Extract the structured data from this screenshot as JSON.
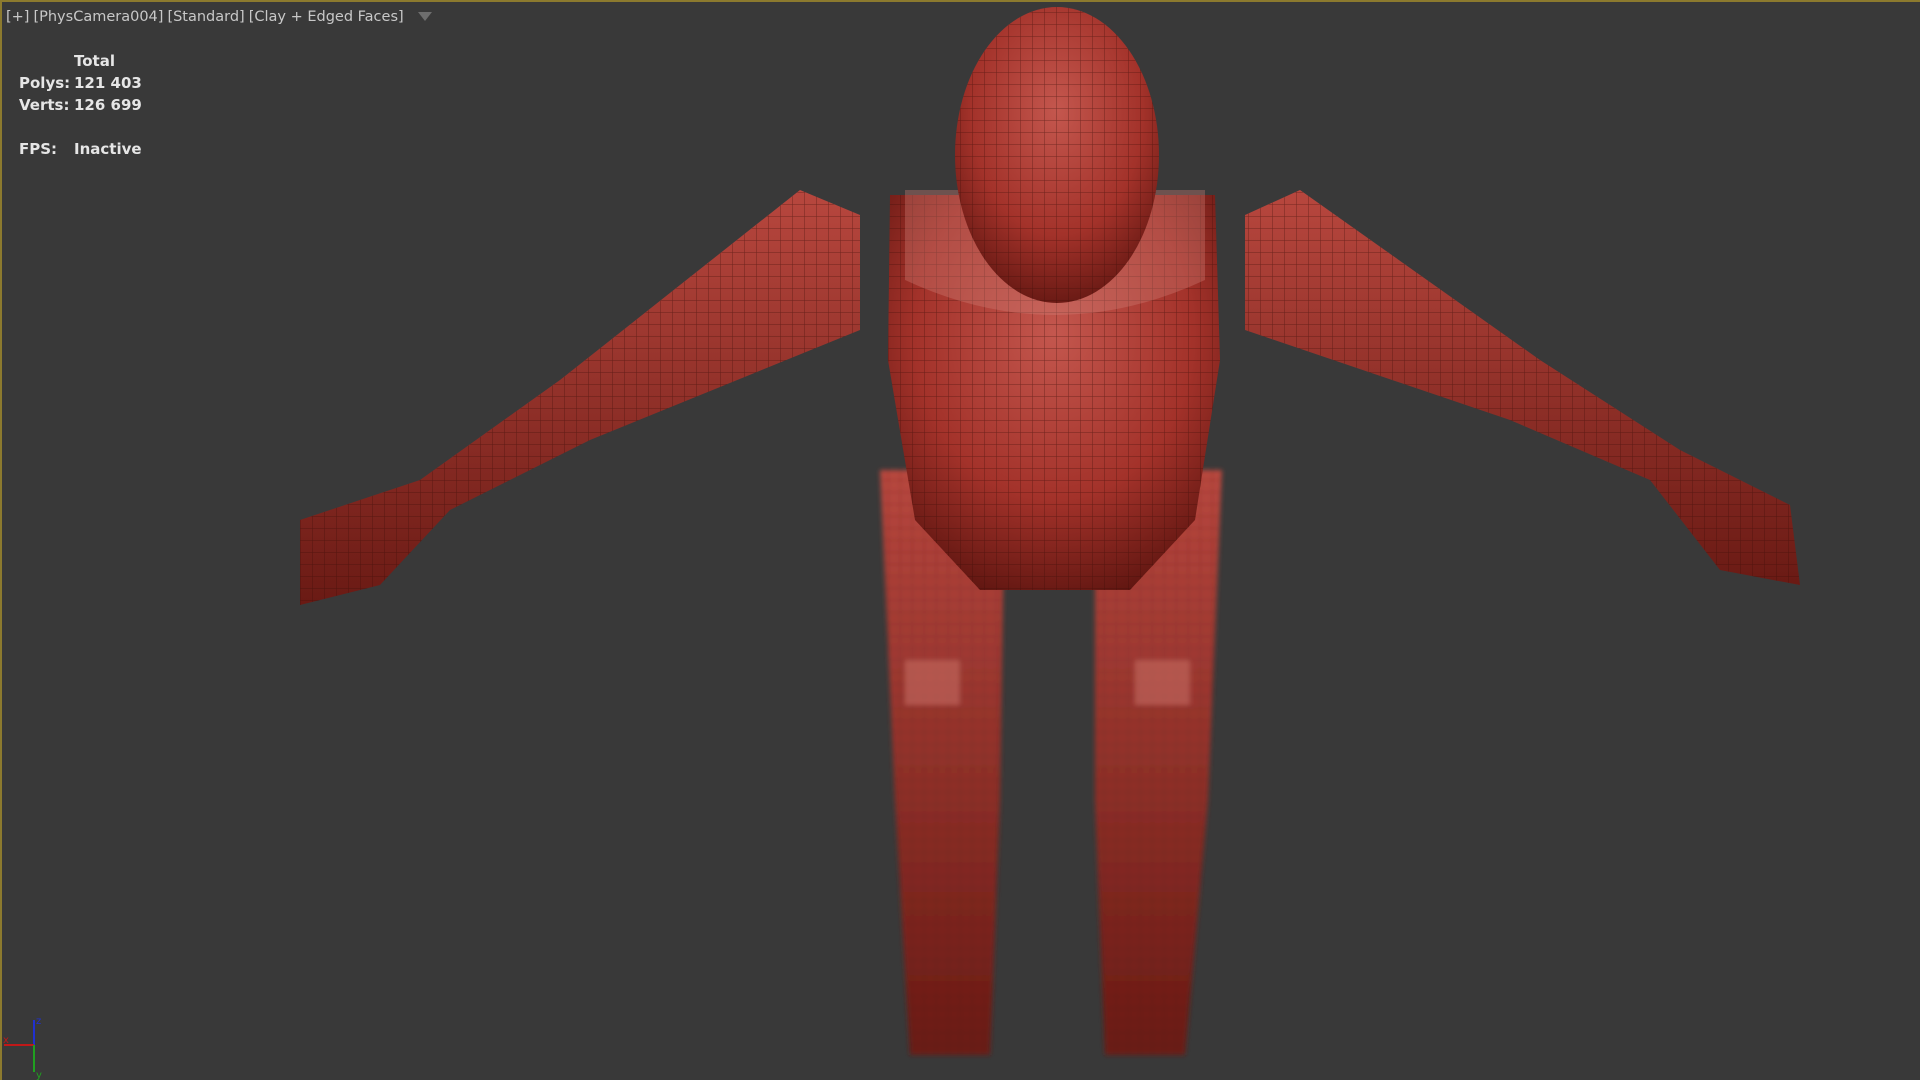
{
  "viewport": {
    "label_items": [
      "[+]",
      "[PhysCamera004]",
      "[Standard]",
      "[Clay + Edged Faces]"
    ],
    "filter_icon": "filter-icon",
    "stats": {
      "header": "Total",
      "polys_label": "Polys:",
      "polys_value": "121 403",
      "verts_label": "Verts:",
      "verts_value": "126 699",
      "fps_label": "FPS:",
      "fps_value": "Inactive"
    },
    "gizmo_axes": [
      "z",
      "y",
      "x"
    ],
    "colors": {
      "background": "#393939",
      "clay": "#a8362e",
      "border": "#8c7a2e"
    }
  }
}
